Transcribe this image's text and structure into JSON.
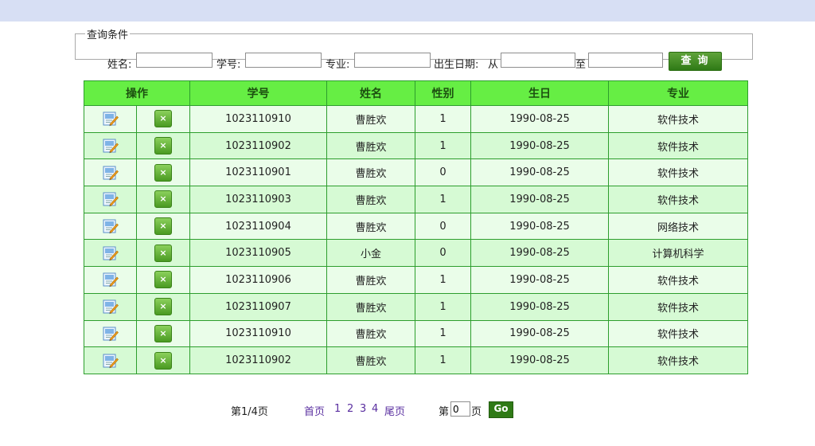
{
  "search": {
    "legend": "查询条件",
    "name_label": "姓名:",
    "id_label": "学号:",
    "major_label": "专业:",
    "birth_label": "出生日期:",
    "from_label": "从",
    "to_label": "至",
    "name_value": "",
    "id_value": "",
    "major_value": "",
    "birth_from_value": "",
    "birth_to_value": "",
    "button_label": "查询"
  },
  "table": {
    "headers": [
      "操作",
      "学号",
      "姓名",
      "性别",
      "生日",
      "专业"
    ],
    "rows": [
      {
        "id": "1023110910",
        "name": "曹胜欢",
        "gender": "1",
        "birthday": "1990-08-25",
        "major": "软件技术"
      },
      {
        "id": "1023110902",
        "name": "曹胜欢",
        "gender": "1",
        "birthday": "1990-08-25",
        "major": "软件技术"
      },
      {
        "id": "1023110901",
        "name": "曹胜欢",
        "gender": "0",
        "birthday": "1990-08-25",
        "major": "软件技术"
      },
      {
        "id": "1023110903",
        "name": "曹胜欢",
        "gender": "1",
        "birthday": "1990-08-25",
        "major": "软件技术"
      },
      {
        "id": "1023110904",
        "name": "曹胜欢",
        "gender": "0",
        "birthday": "1990-08-25",
        "major": "网络技术"
      },
      {
        "id": "1023110905",
        "name": "小金",
        "gender": "0",
        "birthday": "1990-08-25",
        "major": "计算机科学"
      },
      {
        "id": "1023110906",
        "name": "曹胜欢",
        "gender": "1",
        "birthday": "1990-08-25",
        "major": "软件技术"
      },
      {
        "id": "1023110907",
        "name": "曹胜欢",
        "gender": "1",
        "birthday": "1990-08-25",
        "major": "软件技术"
      },
      {
        "id": "1023110910",
        "name": "曹胜欢",
        "gender": "1",
        "birthday": "1990-08-25",
        "major": "软件技术"
      },
      {
        "id": "1023110902",
        "name": "曹胜欢",
        "gender": "1",
        "birthday": "1990-08-25",
        "major": "软件技术"
      }
    ],
    "edit_icon": "edit-icon",
    "delete_icon": "delete-icon"
  },
  "pager": {
    "page_info": "第1/4页",
    "first": "首页",
    "pages": [
      "1",
      "2",
      "3",
      "4"
    ],
    "last": "尾页",
    "jump_prefix": "第",
    "jump_value": "0",
    "jump_suffix": "页",
    "go_label": "Go"
  },
  "colors": {
    "top_bar": "#d7dff4",
    "table_header": "#66ee44",
    "row_odd": "#eafde9",
    "row_even": "#d6fad4",
    "border": "#2d9e2d",
    "button": "#2f7a16",
    "link": "#5a2fa0"
  }
}
